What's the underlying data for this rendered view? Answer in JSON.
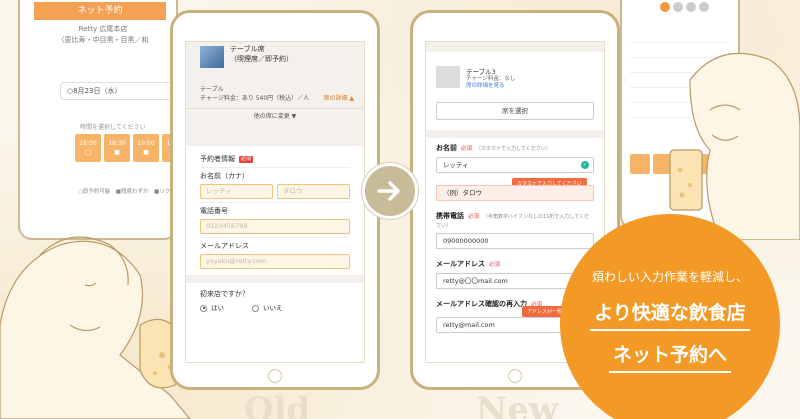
{
  "bg_left": {
    "header": "ネット予約",
    "store_line1": "Retty 広尾本店",
    "store_line2": "（恵比寿・中目黒・目黒／和",
    "date": "○8月23日（水）",
    "hint": "時間を選択してください",
    "slots": [
      {
        "time": "18:00",
        "mark": "◯"
      },
      {
        "time": "18:30",
        "mark": "■"
      },
      {
        "time": "19:00",
        "mark": "■"
      },
      {
        "time": "19:30",
        "mark": "■"
      }
    ],
    "legend": "○即予約可能　■残席わずか　■リクエ"
  },
  "old": {
    "table_name": "テーブル席",
    "table_sub": "（喫煙席／即予約）",
    "table_category": "テーブル",
    "charge": "チャージ料金：あり 540円（税込）／人",
    "details": "席の詳細 ▲",
    "change_seat": "他の席に変更 ▼",
    "reserver_info": "予約者情報",
    "req_badge": "必須",
    "name_label": "お名前（カナ）",
    "last_name_placeholder": "レッティ",
    "first_name_placeholder": "タロウ",
    "phone_label": "電話番号",
    "phone_placeholder": "0123456789",
    "email_label": "メールアドレス",
    "email_placeholder": "yoyaku@retty.com",
    "first_visit": "初来店ですか？",
    "yes": "はい",
    "no": "いいえ"
  },
  "new": {
    "table_name": "テーブル3",
    "charge": "チャージ料金：なし",
    "details": "席の詳細を見る",
    "select_seat": "席を選択",
    "name_label": "お名前",
    "required": "必須",
    "name_hint": "（カタカナで入力してください）",
    "last_name": "レッティ",
    "first_name": "（例）タロウ",
    "name_tip": "カタカナで入力してください",
    "phone_label": "携帯電話",
    "phone_hint": "（半角数字ハイフンなしの11桁で入力してください）",
    "phone_value": "09000000000",
    "email_label": "メールアドレス",
    "email_value": "retty@〇〇mail.com",
    "email_confirm_label": "メールアドレス確認の再入力",
    "email_confirm_value": "retty@mail.com",
    "email_tip": "アドレスが一致しません"
  },
  "labels": {
    "old": "Old",
    "new": "New"
  },
  "badge": {
    "line1": "煩わしい入力作業を軽減し、",
    "line2": "より快適な飲食店",
    "line3": "ネット予約へ"
  },
  "colors": {
    "accent": "#f39a26",
    "tablet_border": "#c9b17f",
    "background": "#fbf7ee"
  }
}
